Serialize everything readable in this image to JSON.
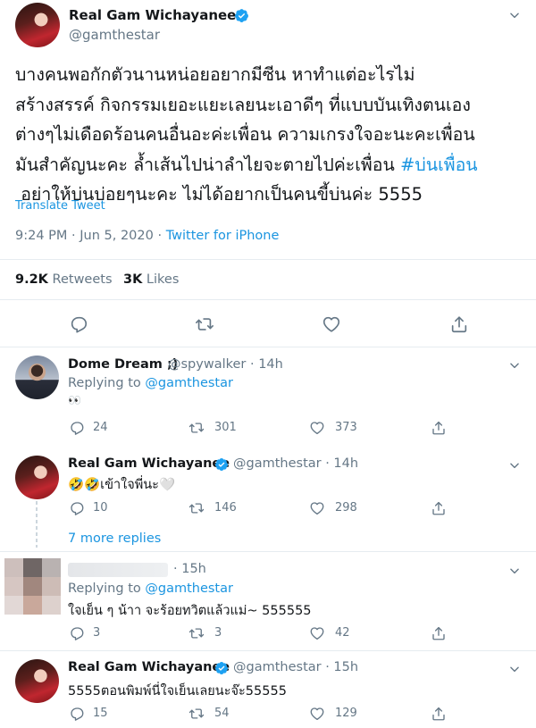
{
  "main_tweet": {
    "author_name": "Real Gam Wichayanee",
    "author_handle": "@gamthestar",
    "text_lines": [
      "บางคนพอกักตัวนานหน่อยอยากมีซีน หาทำแต่อะไรไม่",
      "สร้างสรรค์ กิจกรรมเยอะแยะเลยนะเอาดีๆ ที่แบบบันเทิงตนเอง",
      "ต่างๆไม่เดือดร้อนคนอื่นอะค่ะเพื่อน ความเกรงใจอะนะคะเพื่อน",
      "มันสำคัญนะคะ ล้ำเส้นไปน่าลำไยจะตายไปค่ะเพื่อน "
    ],
    "hashtag": "#บ่นเพื่อน",
    "last_line": " อย่าให้บ่นบ่อยๆนะคะ ไม่ได้อยากเป็นคนขี้บ่นค่ะ 5555",
    "translate_label": "Translate Tweet",
    "time": "9:24 PM · Jun 5, 2020 · ",
    "source": "Twitter for iPhone",
    "retweets_count": "9.2K",
    "retweets_label": " Retweets",
    "likes_count": "3K",
    "likes_label": " Likes"
  },
  "replies": [
    {
      "name": "Dome Dream ;)",
      "handle": "@spywalker · 14h",
      "replying_prefix": "Replying to ",
      "replying_to": "@gamthestar",
      "text": "👀",
      "replies": "24",
      "retweets": "301",
      "likes": "373"
    },
    {
      "name": "Real Gam Wichayanee",
      "handle": "@gamthestar · 14h",
      "text": "🤣🤣เข้าใจพี่นะ🤍",
      "replies": "10",
      "retweets": "146",
      "likes": "298"
    },
    {
      "more_replies": "7 more replies"
    },
    {
      "handle": "· 15h",
      "replying_prefix": "Replying to ",
      "replying_to": "@gamthestar",
      "text": "ใจเย็น ๆ น้าา จะร้อยทวิตแล้วแม่~ 555555",
      "replies": "3",
      "retweets": "3",
      "likes": "42"
    },
    {
      "name": "Real Gam Wichayanee",
      "handle": "@gamthestar · 15h",
      "text": "5555ตอนพิมพ์นี่ใจเย็นเลยนะจ๊ะ55555",
      "replies": "15",
      "retweets": "54",
      "likes": "129"
    }
  ],
  "icons": {
    "verified": "verified-badge-icon",
    "more": "chevron-down-icon",
    "reply": "reply-icon",
    "retweet": "retweet-icon",
    "like": "heart-icon",
    "share": "share-icon"
  },
  "colors": {
    "accent": "#1b95e0",
    "secondary_text": "#657786",
    "border": "#e6ecf0"
  }
}
